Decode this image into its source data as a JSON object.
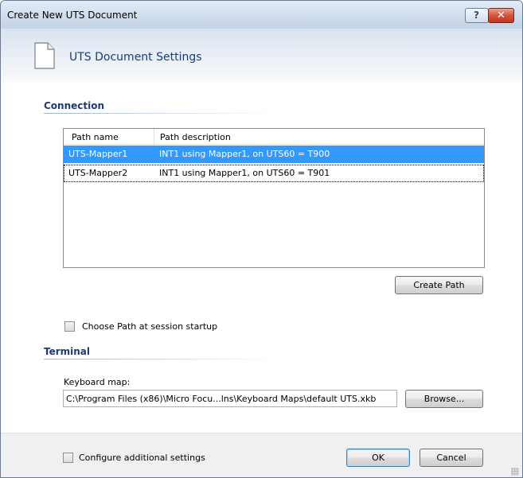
{
  "window": {
    "title": "Create New UTS Document",
    "help_label": "?",
    "close_label": "✕"
  },
  "header": {
    "title": "UTS Document Settings"
  },
  "connection": {
    "section_title": "Connection",
    "columns": [
      "Path name",
      "Path description"
    ],
    "rows": [
      {
        "name": "UTS-Mapper1",
        "description": "INT1 using Mapper1, on UTS60 = T900",
        "selected": true
      },
      {
        "name": "UTS-Mapper2",
        "description": "INT1 using Mapper1, on UTS60 = T901",
        "selected": false
      }
    ],
    "create_path_label": "Create Path",
    "choose_path_label": "Choose Path at session startup",
    "choose_path_checked": false
  },
  "terminal": {
    "section_title": "Terminal",
    "keyboard_map_label": "Keyboard map:",
    "keyboard_map_value": "C:\\Program Files (x86)\\Micro Focu...lns\\Keyboard Maps\\default UTS.xkb",
    "browse_label": "Browse..."
  },
  "footer": {
    "configure_label": "Configure additional settings",
    "configure_checked": false,
    "ok_label": "OK",
    "cancel_label": "Cancel"
  },
  "colors": {
    "selection": "#3399ff",
    "section_title": "#1f3a6f",
    "header_title": "#1a3d7a"
  }
}
